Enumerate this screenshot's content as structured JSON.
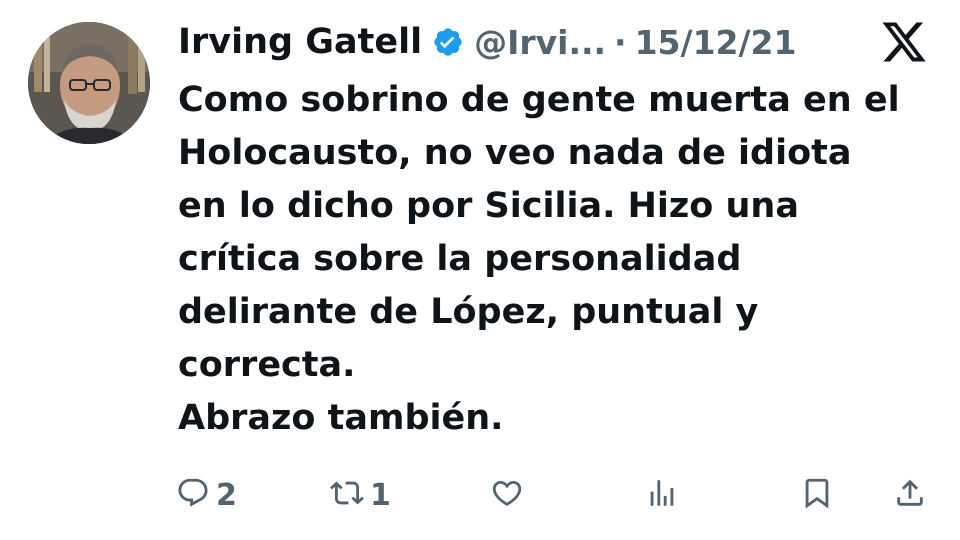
{
  "author": {
    "name": "Irving Gatell",
    "handle": "@Irvi...",
    "verified": true,
    "avatar_icon": "author-photo-avatar"
  },
  "meta": {
    "separator": "·",
    "date": "15/12/21"
  },
  "platform": {
    "logo_icon": "x-logo-icon"
  },
  "tweet": {
    "lines": [
      "Como sobrino de gente muerta en el",
      "Holocausto, no veo nada de idiota",
      "en lo dicho por Sicilia. Hizo una",
      "crítica sobre la personalidad",
      "delirante de López, puntual y",
      "correcta.",
      "Abrazo también."
    ]
  },
  "actions": {
    "reply": {
      "icon": "reply-icon",
      "count": "2"
    },
    "retweet": {
      "icon": "retweet-icon",
      "count": "1"
    },
    "like": {
      "icon": "heart-icon"
    },
    "views": {
      "icon": "views-bar-chart-icon"
    },
    "bookmark": {
      "icon": "bookmark-icon"
    },
    "share": {
      "icon": "share-icon"
    }
  },
  "colors": {
    "text": "#0f1419",
    "secondary": "#536471",
    "verified_blue": "#1d9bf0",
    "background": "#ffffff"
  }
}
